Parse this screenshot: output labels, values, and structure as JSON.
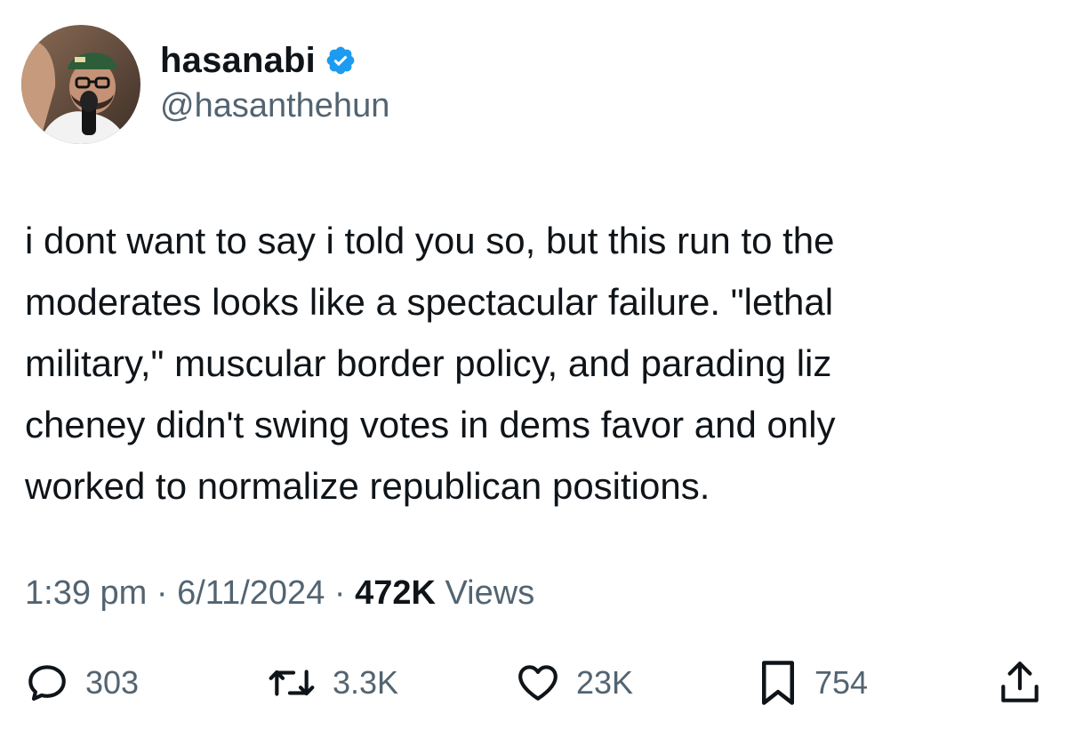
{
  "user": {
    "display_name": "hasanabi",
    "handle": "@hasanthehun",
    "verified": true,
    "avatar": "profile-photo"
  },
  "tweet": {
    "text": "i dont want to say i told you so, but this run to the\nmoderates looks like a spectacular failure. \"lethal\nmilitary,\" muscular border policy, and parading liz\ncheney didn't swing votes in dems favor and only\nworked to normalize republican positions."
  },
  "meta": {
    "time": "1:39 pm",
    "separator": "·",
    "date": "6/11/2024",
    "views_count": "472K",
    "views_label": "Views"
  },
  "actions": {
    "replies": {
      "icon": "reply-icon",
      "count": "303"
    },
    "retweets": {
      "icon": "retweet-icon",
      "count": "3.3K"
    },
    "likes": {
      "icon": "heart-icon",
      "count": "23K"
    },
    "bookmarks": {
      "icon": "bookmark-icon",
      "count": "754"
    },
    "share": {
      "icon": "share-icon"
    }
  },
  "colors": {
    "text": "#0f1419",
    "secondary": "#536471",
    "verified": "#1d9bf0"
  }
}
